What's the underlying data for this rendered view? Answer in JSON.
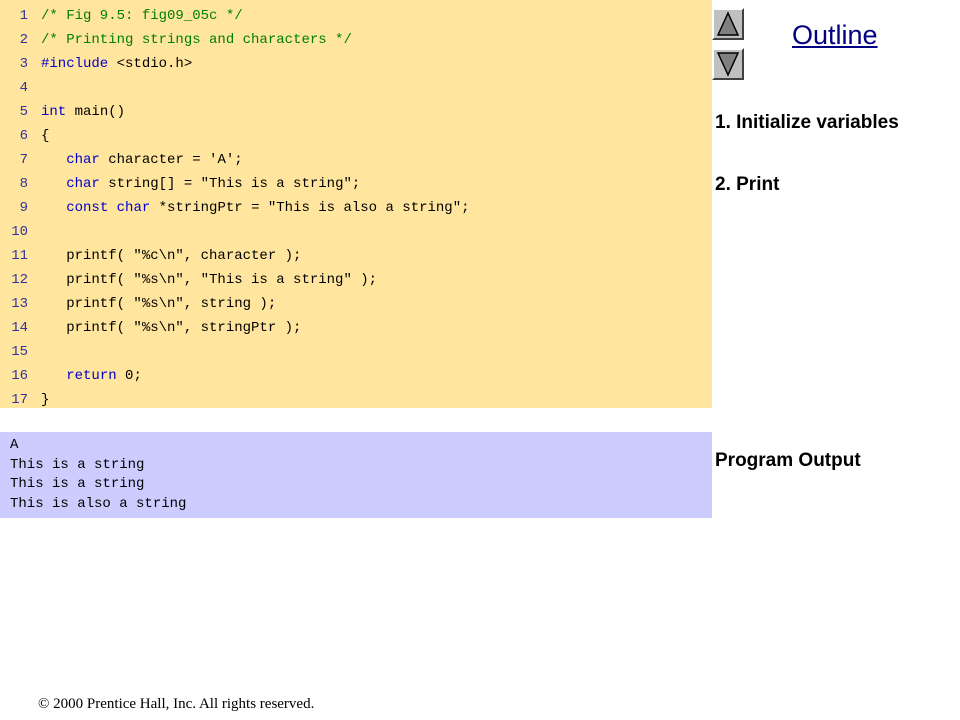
{
  "code": {
    "lines": [
      {
        "num": "1",
        "tokens": [
          {
            "t": "/* Fig 9.5: fig09_05c */",
            "k": "comment"
          }
        ]
      },
      {
        "num": "2",
        "tokens": [
          {
            "t": "/* Printing strings and characters */",
            "k": "comment"
          }
        ]
      },
      {
        "num": "3",
        "tokens": [
          {
            "t": "#include",
            "k": "keyword"
          },
          {
            "t": " <stdio.h>",
            "k": "plain"
          }
        ]
      },
      {
        "num": "4",
        "tokens": []
      },
      {
        "num": "5",
        "tokens": [
          {
            "t": "int",
            "k": "keyword"
          },
          {
            "t": " main()",
            "k": "plain"
          }
        ]
      },
      {
        "num": "6",
        "tokens": [
          {
            "t": "{",
            "k": "plain"
          }
        ]
      },
      {
        "num": "7",
        "tokens": [
          {
            "t": "   ",
            "k": "plain"
          },
          {
            "t": "char",
            "k": "keyword"
          },
          {
            "t": " character = 'A';",
            "k": "plain"
          }
        ]
      },
      {
        "num": "8",
        "tokens": [
          {
            "t": "   ",
            "k": "plain"
          },
          {
            "t": "char",
            "k": "keyword"
          },
          {
            "t": " string[] = \"This is a string\";",
            "k": "plain"
          }
        ]
      },
      {
        "num": "9",
        "tokens": [
          {
            "t": "   ",
            "k": "plain"
          },
          {
            "t": "const",
            "k": "keyword"
          },
          {
            "t": " ",
            "k": "plain"
          },
          {
            "t": "char",
            "k": "keyword"
          },
          {
            "t": " *stringPtr = \"This is also a string\";",
            "k": "plain"
          }
        ]
      },
      {
        "num": "10",
        "tokens": []
      },
      {
        "num": "11",
        "tokens": [
          {
            "t": "   printf( \"%c\\n\", character );",
            "k": "plain"
          }
        ]
      },
      {
        "num": "12",
        "tokens": [
          {
            "t": "   printf( \"%s\\n\", \"This is a string\" );",
            "k": "plain"
          }
        ]
      },
      {
        "num": "13",
        "tokens": [
          {
            "t": "   printf( \"%s\\n\", string );",
            "k": "plain"
          }
        ]
      },
      {
        "num": "14",
        "tokens": [
          {
            "t": "   printf( \"%s\\n\", stringPtr );",
            "k": "plain"
          }
        ]
      },
      {
        "num": "15",
        "tokens": []
      },
      {
        "num": "16",
        "tokens": [
          {
            "t": "   ",
            "k": "plain"
          },
          {
            "t": "return",
            "k": "keyword"
          },
          {
            "t": " 0;",
            "k": "plain"
          }
        ]
      },
      {
        "num": "17",
        "tokens": [
          {
            "t": "}",
            "k": "plain"
          }
        ]
      }
    ]
  },
  "output": {
    "lines": [
      "A",
      "This is a string",
      "This is a string",
      "This is also a string"
    ]
  },
  "sidebar": {
    "title": "Outline",
    "items": [
      "1. Initialize variables",
      "2. Print",
      "Program Output"
    ],
    "nav_up_icon": "triangle-up-icon",
    "nav_down_icon": "triangle-down-icon"
  },
  "footer": {
    "copyright_symbol": "©",
    "text": " 2000 Prentice Hall, Inc.  All rights reserved."
  },
  "colors": {
    "code_bg": "#ffe59e",
    "output_bg": "#ccccff",
    "comment": "#008000",
    "keyword": "#0000cc",
    "line_number": "#333399",
    "outline_title": "#000080"
  }
}
